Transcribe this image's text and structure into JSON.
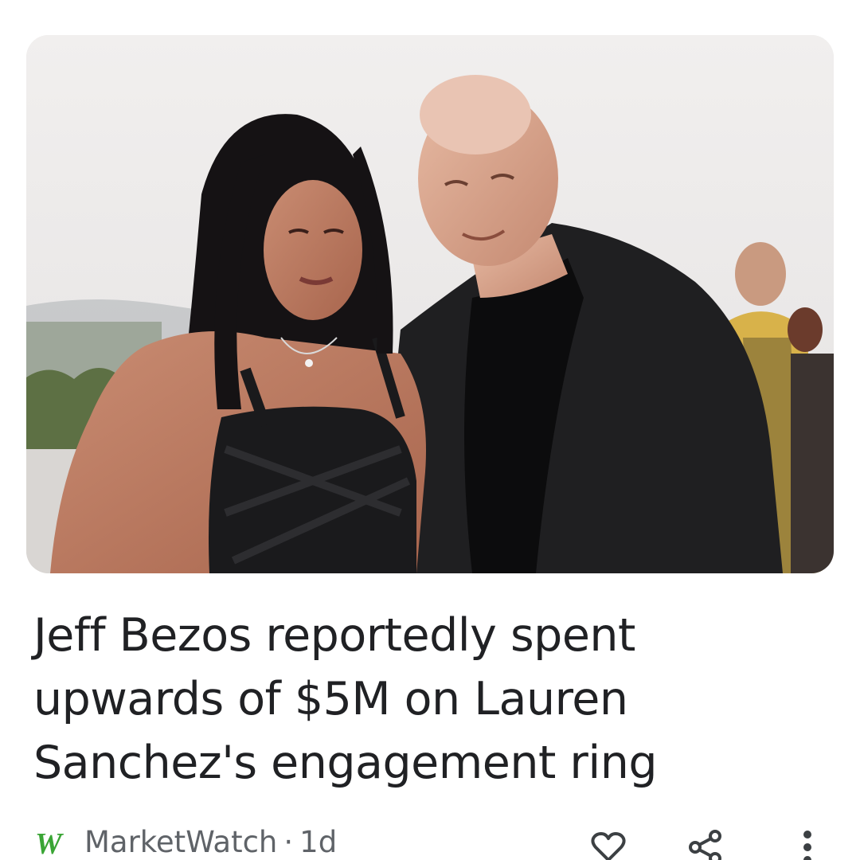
{
  "article": {
    "headline": "Jeff Bezos reportedly spent upwards of $5M on Lauren Sanchez's engagement ring",
    "image_icon": "photo-couple-at-event",
    "source": {
      "name": "MarketWatch",
      "separator": "·",
      "age": "1d",
      "logo_icon": "marketwatch-logo-icon",
      "logo_text": "W",
      "logo_color": "#3aa535"
    }
  },
  "actions": {
    "like_icon": "heart-outline-icon",
    "share_icon": "share-icon",
    "more_icon": "more-vertical-icon"
  },
  "colors": {
    "headline": "#202124",
    "meta": "#5f6368",
    "icons": "#3c4043"
  }
}
